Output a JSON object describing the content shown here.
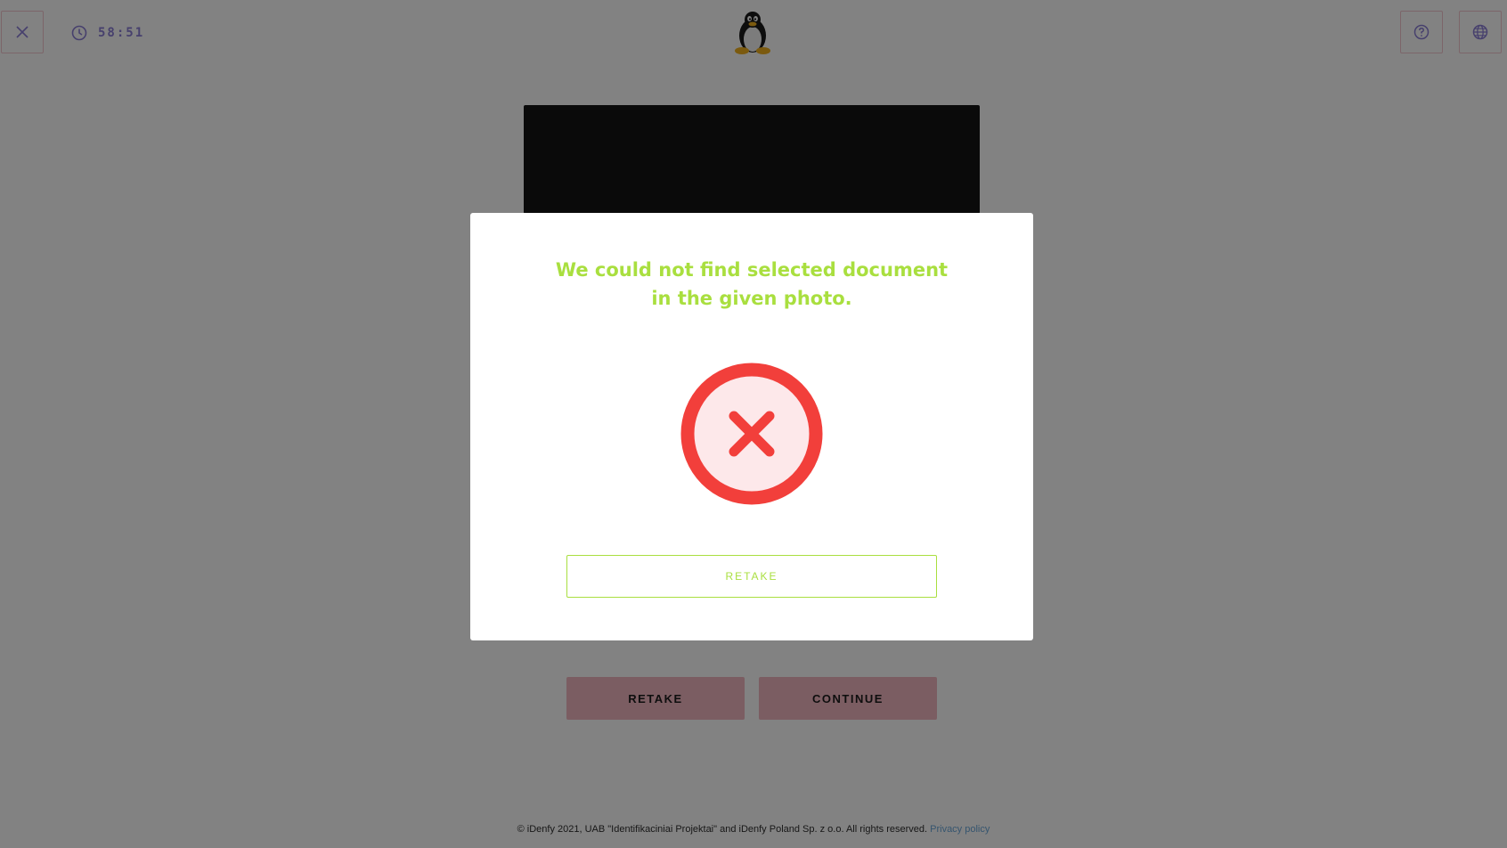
{
  "header": {
    "timer": "58:51",
    "close_icon": "close-icon",
    "clock_icon": "clock-icon",
    "help_icon": "help-circle-icon",
    "language_icon": "globe-icon",
    "logo_icon": "linux-penguin-logo"
  },
  "actions": {
    "retake_label": "RETAKE",
    "continue_label": "CONTINUE"
  },
  "footer": {
    "copyright": "© iDenfy 2021, UAB \"Identifikaciniai Projektai\" and iDenfy Poland Sp. z o.o. All rights reserved.",
    "privacy_label": "Privacy policy"
  },
  "modal": {
    "title_line1": "We could not find selected document",
    "title_line2": "in the given photo.",
    "status_icon": "error-x-circle-icon",
    "retake_label": "RETAKE"
  },
  "colors": {
    "accent_green": "#a9df3f",
    "error_red": "#f23f3b",
    "error_fill": "#fde8ea",
    "button_pink": "#f2b6c0",
    "icon_purple": "#8b7fd6"
  }
}
